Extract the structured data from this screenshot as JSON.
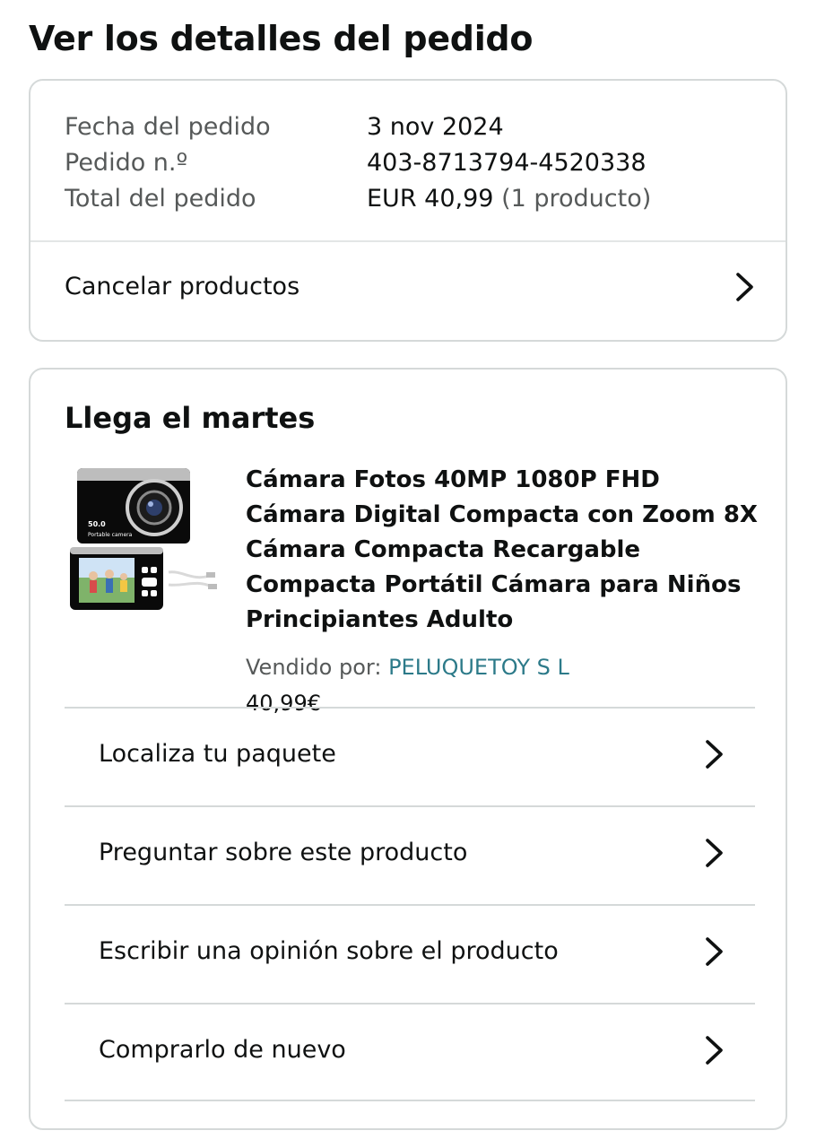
{
  "page": {
    "title": "Ver los detalles del pedido"
  },
  "order_summary": {
    "rows": [
      {
        "label": "Fecha del pedido",
        "value": "3 nov 2024",
        "note": ""
      },
      {
        "label": "Pedido n.º",
        "value": "403-8713794-4520338",
        "note": ""
      },
      {
        "label": "Total del pedido",
        "value": "EUR 40,99",
        "note": "(1 producto)"
      }
    ],
    "cancel_label": "Cancelar productos"
  },
  "shipment": {
    "heading": "Llega el martes",
    "product": {
      "title": "Cámara Fotos 40MP 1080P FHD Cámara Digital Compacta con Zoom 8X Cámara Compacta Recargable Compacta Portátil Cámara para Niños Principiantes Adulto",
      "sold_by_label": "Vendido por:",
      "seller": "PELUQUETOY S L",
      "price": "40,99€",
      "image_text": {
        "megapixels": "50.0",
        "model": "Portable camera"
      }
    },
    "actions": [
      {
        "label": "Localiza tu paquete",
        "icon": "chevron-right-icon"
      },
      {
        "label": "Preguntar sobre este producto",
        "icon": "chevron-right-icon"
      },
      {
        "label": "Escribir una opinión sobre el producto",
        "icon": "chevron-right-icon"
      },
      {
        "label": "Comprarlo de nuevo",
        "icon": "chevron-right-icon"
      }
    ]
  },
  "colors": {
    "text": "#0f1111",
    "muted_text": "#565959",
    "link": "#2c7a89",
    "border": "#d5d9d9"
  }
}
